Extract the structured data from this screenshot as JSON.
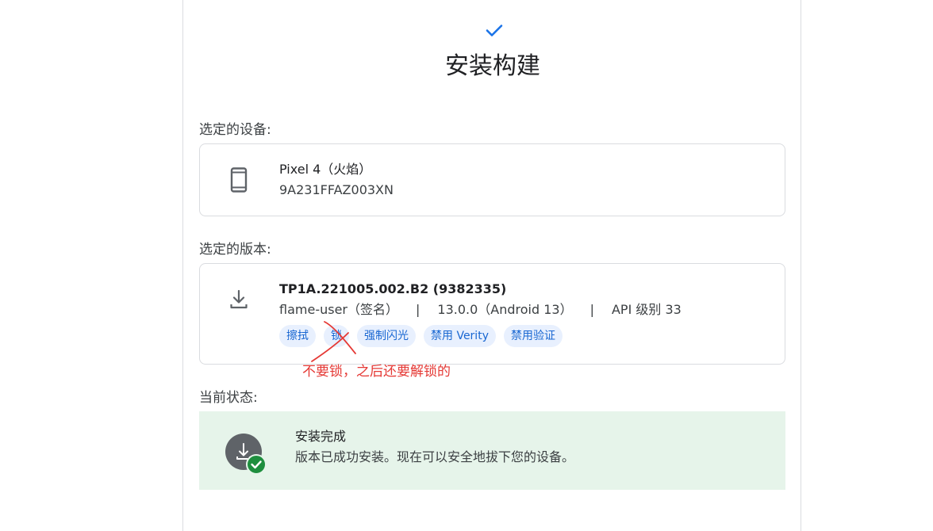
{
  "header": {
    "title": "安装构建"
  },
  "device_section": {
    "label": "选定的设备:",
    "device_name": "Pixel 4（火焰）",
    "serial": "9A231FFAZ003XN"
  },
  "build_section": {
    "label": "选定的版本:",
    "build_id": "TP1A.221005.002.B2 (9382335)",
    "target": "flame-user（签名）",
    "separator": "|",
    "version": "13.0.0（Android 13）",
    "api_level": "API 级别 33",
    "options": [
      "擦拭",
      "锁",
      "强制闪光",
      "禁用 Verity",
      "禁用验证"
    ]
  },
  "annotation": {
    "text": "不要锁，之后还要解锁的",
    "color": "#e53935"
  },
  "status_section": {
    "label": "当前状态:",
    "title": "安装完成",
    "description": "版本已成功安装。现在可以安全地拔下您的设备。"
  },
  "colors": {
    "accent": "#1a73e8",
    "chip_bg": "#e8f0fe",
    "chip_text": "#1967d2",
    "success_bg": "#e6f4ea",
    "success_badge": "#1e8e3e"
  },
  "icons": {
    "header": "check-icon",
    "device": "phone-icon",
    "build": "download-icon",
    "status": "download-success-icon"
  }
}
